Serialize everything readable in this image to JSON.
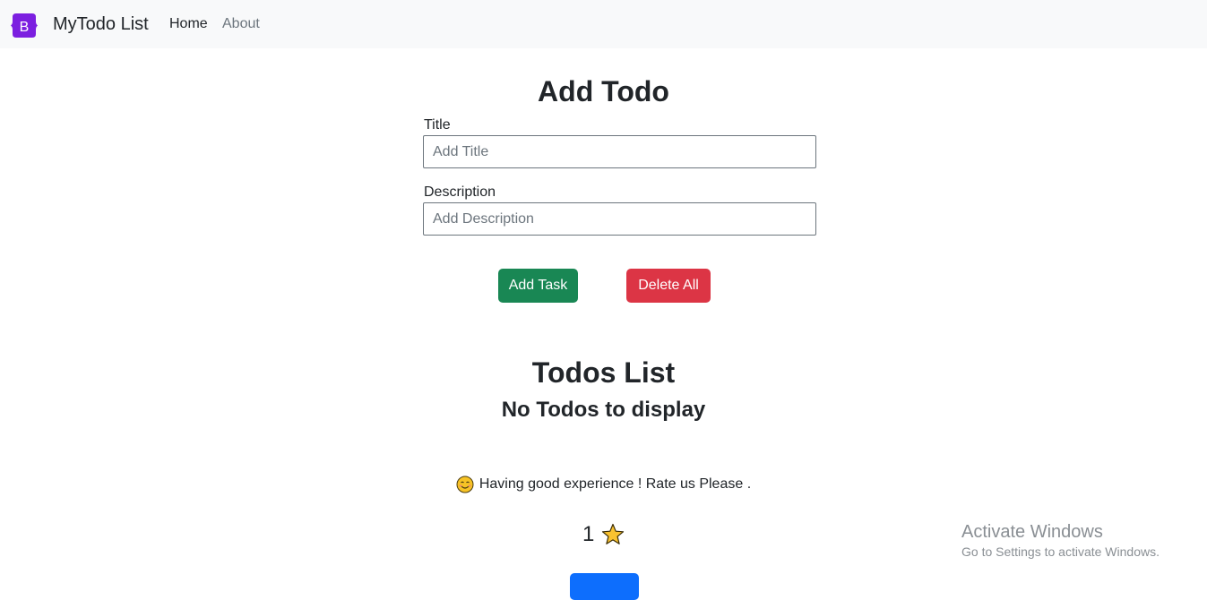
{
  "navbar": {
    "brand": "MyTodo List",
    "links": [
      {
        "label": "Home"
      },
      {
        "label": "About"
      }
    ]
  },
  "add_form": {
    "heading": "Add Todo",
    "title_label": "Title",
    "title_placeholder": "Add Title",
    "title_value": "",
    "desc_label": "Description",
    "desc_placeholder": "Add Description",
    "desc_value": "",
    "add_button": "Add Task",
    "delete_button": "Delete All"
  },
  "todos": {
    "heading": "Todos List",
    "empty_message": "No Todos to display"
  },
  "rating": {
    "prompt": "Having good experience ! Rate us Please .",
    "value": "1"
  },
  "watermark": {
    "title": "Activate Windows",
    "subtitle": "Go to Settings to activate Windows."
  },
  "colors": {
    "brand_purple": "#7952b3",
    "success": "#198754",
    "danger": "#dc3545",
    "primary": "#0d6efd"
  }
}
